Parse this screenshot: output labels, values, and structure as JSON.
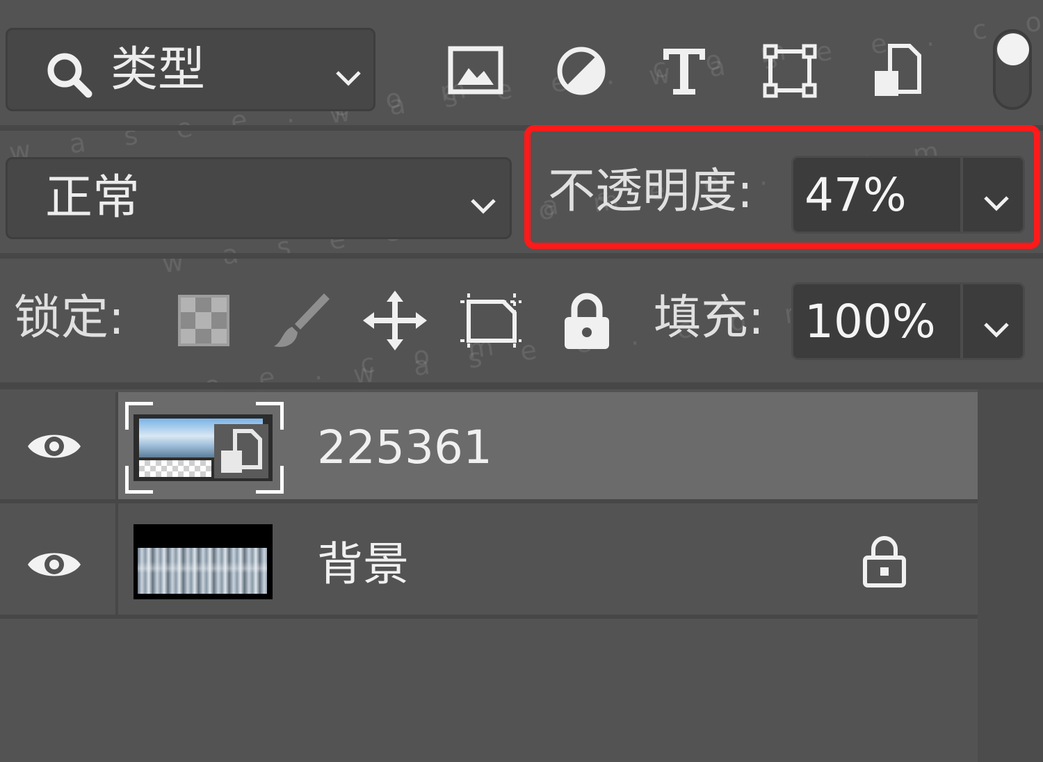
{
  "filter": {
    "search_icon": "search-icon",
    "label": "类型",
    "kind_icons": [
      "image-filter-icon",
      "adjustment-filter-icon",
      "type-filter-icon",
      "shape-filter-icon",
      "smart-object-filter-icon"
    ]
  },
  "blend": {
    "mode": "正常"
  },
  "opacity": {
    "label": "不透明度:",
    "value": "47%",
    "highlight_color": "#ff1a1a"
  },
  "lock": {
    "label": "锁定:",
    "icons": [
      "lock-transparent-pixels-icon",
      "lock-image-pixels-icon",
      "lock-position-icon",
      "lock-artboard-icon",
      "lock-all-icon"
    ]
  },
  "fill": {
    "label": "填充:",
    "value": "100%"
  },
  "layers": [
    {
      "name": "225361",
      "visible": true,
      "selected": true,
      "smart_object": true,
      "locked": false
    },
    {
      "name": "背景",
      "visible": true,
      "selected": false,
      "smart_object": false,
      "locked": true
    }
  ],
  "watermark": "w a s e e . c o m"
}
